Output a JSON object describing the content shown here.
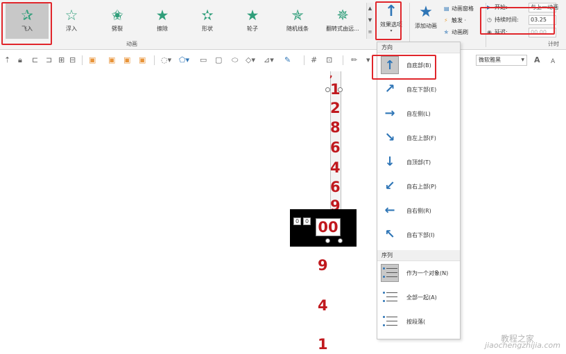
{
  "ribbon": {
    "animations": [
      {
        "label": "飞入",
        "icon": "fly-in-star-icon",
        "color": "#2f9e7a",
        "selected": true
      },
      {
        "label": "浮入",
        "icon": "float-in-star-icon",
        "color": "#2f9e7a"
      },
      {
        "label": "劈裂",
        "icon": "split-star-icon",
        "color": "#2f9e7a"
      },
      {
        "label": "擦除",
        "icon": "wipe-star-icon",
        "color": "#2f9e7a"
      },
      {
        "label": "形状",
        "icon": "shape-star-icon",
        "color": "#2f9e7a"
      },
      {
        "label": "轮子",
        "icon": "wheel-star-icon",
        "color": "#2f9e7a"
      },
      {
        "label": "随机线条",
        "icon": "random-bars-star-icon",
        "color": "#2f9e7a"
      },
      {
        "label": "翻转式由远...",
        "icon": "grow-turn-star-icon",
        "color": "#2f9e7a"
      }
    ],
    "animation_group_label": "动画",
    "effect_options_label": "效果选项",
    "add_animation_label": "添加动画",
    "advanced": [
      {
        "label": "动画窗格",
        "icon": "animation-pane-icon"
      },
      {
        "label": "触发 ·",
        "icon": "trigger-icon"
      },
      {
        "label": "动画刷",
        "icon": "animation-painter-icon"
      }
    ],
    "timing": {
      "start_label": "开始:",
      "start_value": "与上一动画",
      "duration_label": "持续时间:",
      "duration_value": "03.25",
      "delay_label": "延迟:",
      "delay_value": "00.00"
    },
    "timing_group_label": "计时"
  },
  "toolbar": {
    "font_name": "微软雅黑",
    "grow_font": "A",
    "shrink_font": "A"
  },
  "canvas": {
    "digits": [
      "1",
      "2",
      "8",
      "6",
      "4",
      "6",
      "9"
    ],
    "counter_text": "00",
    "cell_a": "0",
    "cell_b": "0",
    "lower_digits": [
      "9",
      "4",
      "1"
    ]
  },
  "dropdown": {
    "direction_header": "方向",
    "directions": [
      {
        "label": "自底部(B)",
        "glyph": "↑",
        "icon": "arrow-up-icon",
        "selected": true
      },
      {
        "label": "自左下部(E)",
        "glyph": "↗",
        "icon": "arrow-up-right-icon"
      },
      {
        "label": "自左侧(L)",
        "glyph": "→",
        "icon": "arrow-right-icon"
      },
      {
        "label": "自左上部(F)",
        "glyph": "↘",
        "icon": "arrow-down-right-icon"
      },
      {
        "label": "自顶部(T)",
        "glyph": "↓",
        "icon": "arrow-down-icon"
      },
      {
        "label": "自右上部(P)",
        "glyph": "↙",
        "icon": "arrow-down-left-icon"
      },
      {
        "label": "自右侧(R)",
        "glyph": "←",
        "icon": "arrow-left-icon"
      },
      {
        "label": "自右下部(I)",
        "glyph": "↖",
        "icon": "arrow-up-left-icon"
      }
    ],
    "sequence_header": "序列",
    "sequences": [
      {
        "label": "作为一个对象(N)",
        "icon": "as-one-object-icon",
        "selected": true
      },
      {
        "label": "全部一起(A)",
        "icon": "all-at-once-icon"
      },
      {
        "label": "按段落(",
        "icon": "by-paragraph-icon"
      }
    ]
  },
  "watermark": {
    "latin": "jiaochengzhijia.com",
    "cjk": "教程之家"
  },
  "colors": {
    "accent_blue": "#2e75b6",
    "highlight_red": "#e0252a",
    "digit_red": "#c0191e"
  }
}
